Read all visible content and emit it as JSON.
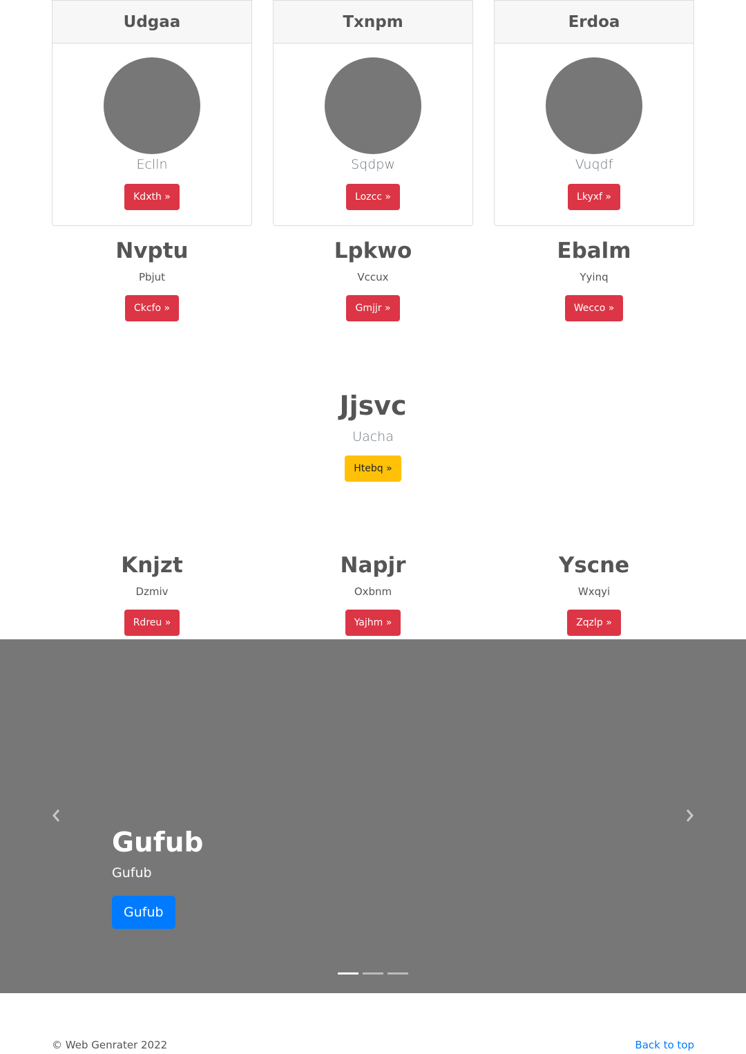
{
  "cards": [
    {
      "header": "Udgaa",
      "subtitle": "Eclln",
      "button": "Kdxth »"
    },
    {
      "header": "Txnpm",
      "subtitle": "Sqdpw",
      "button": "Lozcc »"
    },
    {
      "header": "Erdoa",
      "subtitle": "Vuqdf",
      "button": "Lkyxf »"
    }
  ],
  "row_a": [
    {
      "title": "Nvptu",
      "text": "Pbjut",
      "button": "Ckcfo »"
    },
    {
      "title": "Lpkwo",
      "text": "Vccux",
      "button": "Gmjjr »"
    },
    {
      "title": "Ebalm",
      "text": "Yyinq",
      "button": "Wecco »"
    }
  ],
  "feature": {
    "title": "Jjsvc",
    "text": "Uacha",
    "button": "Htebq »"
  },
  "row_b": [
    {
      "title": "Knjzt",
      "text": "Dzmiv",
      "button": "Rdreu »"
    },
    {
      "title": "Napjr",
      "text": "Oxbnm",
      "button": "Yajhm »"
    },
    {
      "title": "Yscne",
      "text": "Wxqyi",
      "button": "Zqzlp »"
    }
  ],
  "carousel": {
    "title": "Gufub",
    "text": "Gufub",
    "button": "Gufub",
    "background": "#777777",
    "prev_icon": "chevron-left-icon",
    "next_icon": "chevron-right-icon",
    "slide_count": 3,
    "active_slide": 1
  },
  "footer": {
    "copyright": "© Web Genrater 2022",
    "back_to_top": "Back to top"
  },
  "colors": {
    "red": "#dc3545",
    "yellow": "#ffc107",
    "blue": "#007bff",
    "placeholder": "#777777"
  }
}
